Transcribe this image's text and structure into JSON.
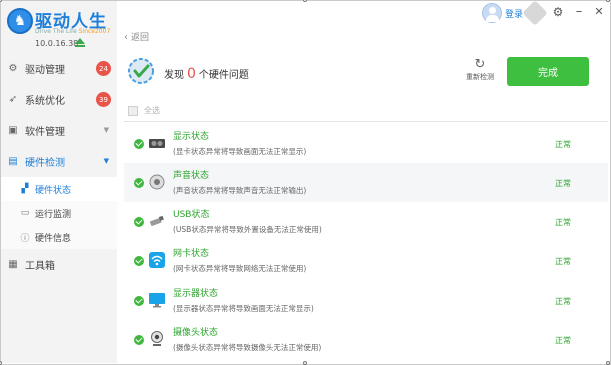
{
  "app": {
    "brand": "驱动人生",
    "tagline": "Drive The Life",
    "since": "Since2007",
    "version": "10.0.16.38"
  },
  "header": {
    "login_label": "登录"
  },
  "sidebar": {
    "items": [
      {
        "label": "驱动管理",
        "badge": "24"
      },
      {
        "label": "系统优化",
        "badge": "39"
      },
      {
        "label": "软件管理"
      },
      {
        "label": "硬件检测"
      },
      {
        "label": "工具箱"
      }
    ],
    "submenu": [
      {
        "label": "硬件状态"
      },
      {
        "label": "运行监测"
      },
      {
        "label": "硬件信息"
      }
    ]
  },
  "main": {
    "back_label": "返回",
    "summary_prefix": "发现",
    "problem_count": "0",
    "summary_suffix": "个硬件问题",
    "rescan_label": "重新检测",
    "done_label": "完成",
    "select_all_label": "全选",
    "rows": [
      {
        "title": "显示状态",
        "desc": "(显卡状态异常将导致画面无法正常显示)",
        "status": "正常",
        "icon": "graphics-card-icon"
      },
      {
        "title": "声音状态",
        "desc": "(声音状态异常将导致声音无法正常输出)",
        "status": "正常",
        "icon": "speaker-icon"
      },
      {
        "title": "USB状态",
        "desc": "(USB状态异常将导致外置设备无法正常使用)",
        "status": "正常",
        "icon": "usb-icon"
      },
      {
        "title": "网卡状态",
        "desc": "(网卡状态异常将导致网络无法正常使用)",
        "status": "正常",
        "icon": "wifi-icon"
      },
      {
        "title": "显示器状态",
        "desc": "(显示器状态异常将导致画面无法正常显示)",
        "status": "正常",
        "icon": "monitor-icon"
      },
      {
        "title": "摄像头状态",
        "desc": "(摄像头状态异常将导致摄像头无法正常使用)",
        "status": "正常",
        "icon": "webcam-icon"
      }
    ]
  },
  "colors": {
    "accent": "#1e7fd8",
    "ok_green": "#2ea42e",
    "done_button": "#3fbf3f",
    "badge_red": "#e8534a"
  }
}
